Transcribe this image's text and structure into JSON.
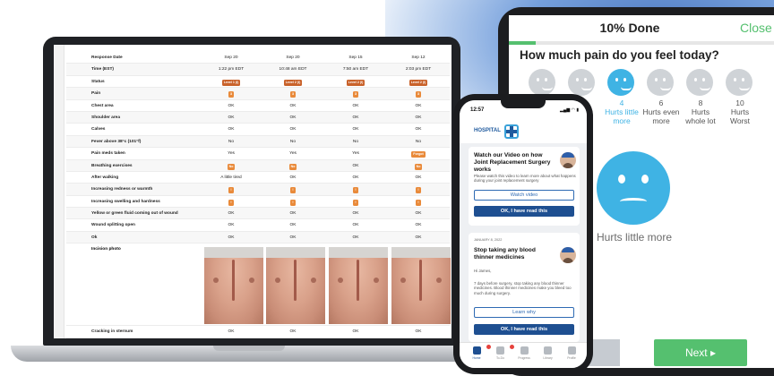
{
  "laptop": {
    "table": {
      "header_label": "Response Date",
      "columns": [
        "Sep 20",
        "Sep 20",
        "Sep 15",
        "Sep 12"
      ],
      "rows": [
        {
          "label": "Time (EST)",
          "cells": [
            "1:22 pm EDT",
            "10:48 am EDT",
            "7:50 am EDT",
            "2:03 pm EDT"
          ]
        },
        {
          "label": "Status",
          "cells": [
            "Level 1 (I)",
            "Level 2 (I)",
            "Level 2 (I)",
            "Level 2 (I)"
          ],
          "badges": true
        },
        {
          "label": "Pain",
          "cells": [
            "3",
            "3",
            "3",
            "3"
          ],
          "badges": true
        },
        {
          "label": "Chest area",
          "cells": [
            "OK",
            "OK",
            "OK",
            "OK"
          ]
        },
        {
          "label": "Shoulder area",
          "cells": [
            "OK",
            "OK",
            "OK",
            "OK"
          ]
        },
        {
          "label": "Calves",
          "cells": [
            "OK",
            "OK",
            "OK",
            "OK"
          ]
        },
        {
          "label": "Fever above 38°c (101°f)",
          "cells": [
            "No",
            "No",
            "No",
            "No"
          ]
        },
        {
          "label": "Pain meds taken",
          "cells": [
            "Yes",
            "Yes",
            "Yes",
            "Forgot"
          ],
          "badge_cols": [
            3
          ]
        },
        {
          "label": "Breathing exercises",
          "cells": [
            "No",
            "No",
            "OK",
            "No"
          ],
          "badge_cols": [
            0,
            1,
            3
          ]
        },
        {
          "label": "After walking",
          "cells": [
            "A little tired",
            "OK",
            "OK",
            "OK"
          ]
        },
        {
          "label": "Increasing redness or warmth",
          "cells": [
            "!",
            "!",
            "!",
            "!"
          ],
          "badges": true
        },
        {
          "label": "Increasing swelling and hardness",
          "cells": [
            "!",
            "!",
            "!",
            "!"
          ],
          "badges": true
        },
        {
          "label": "Yellow or green fluid coming out of wound",
          "cells": [
            "OK",
            "OK",
            "OK",
            "OK"
          ]
        },
        {
          "label": "Wound splitting open",
          "cells": [
            "OK",
            "OK",
            "OK",
            "OK"
          ]
        },
        {
          "label": "Ok",
          "cells": [
            "OK",
            "OK",
            "OK",
            "OK"
          ]
        }
      ],
      "photo_row_label": "Incision photo",
      "last_row": {
        "label": "Cracking in sternum",
        "cells": [
          "OK",
          "OK",
          "OK",
          "OK"
        ]
      }
    }
  },
  "tablet": {
    "title": "10% Done",
    "close_label": "Close",
    "progress_percent": 10,
    "question": "How much pain do you feel today?",
    "faces": [
      {
        "value": "",
        "label": ""
      },
      {
        "value": "",
        "label": ""
      },
      {
        "value": "4",
        "label": "Hurts little more",
        "selected": true
      },
      {
        "value": "6",
        "label": "Hurts even more"
      },
      {
        "value": "8",
        "label": "Hurts whole lot"
      },
      {
        "value": "10",
        "label": "Hurts Worst"
      }
    ],
    "selected_label": "Hurts little more",
    "next_label": "Next"
  },
  "phone": {
    "time": "12:57",
    "status_icons": "▂▄▆ ◠ ▮",
    "logo_text": "HOSPITAL",
    "card1": {
      "title": "Watch our Video on how Joint Replacement Surgery works",
      "body": "Please watch this video to learn more about what happens during your joint replacement surgery",
      "button_outline": "Watch video",
      "button_solid": "OK, I have read this"
    },
    "card2": {
      "date": "JANUARY 8, 2022",
      "title": "Stop taking any blood thinner medicines",
      "greeting": "Hi James,",
      "body": "7 days before surgery, stop taking any blood thinner medicines. Blood thinner medicines make you bleed too much during surgery.",
      "button_outline": "Learn why",
      "button_solid": "OK, I have read this"
    },
    "tabs": [
      {
        "label": "Home",
        "icon": "home-icon",
        "active": true,
        "dot": true
      },
      {
        "label": "To-Do",
        "icon": "todo-icon",
        "dot": true
      },
      {
        "label": "Progress",
        "icon": "progress-icon"
      },
      {
        "label": "Library",
        "icon": "library-icon"
      },
      {
        "label": "Profile",
        "icon": "profile-icon"
      }
    ]
  }
}
